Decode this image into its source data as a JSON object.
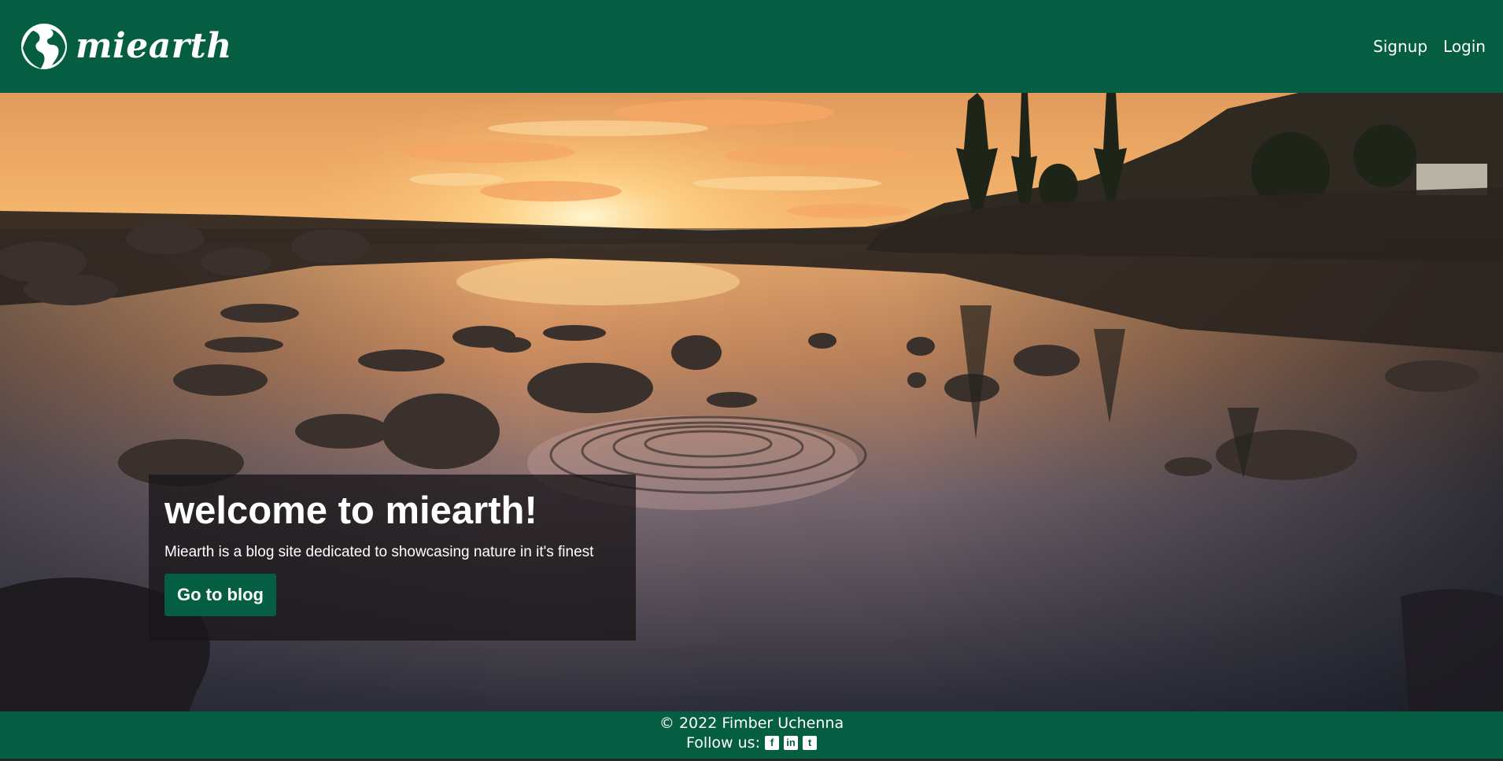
{
  "header": {
    "brand": "miearth",
    "nav": {
      "signup": "Signup",
      "login": "Login"
    }
  },
  "hero": {
    "title": "welcome to miearth!",
    "description": "Miearth is a blog site dedicated to showcasing nature in it's finest",
    "button_label": "Go to blog"
  },
  "footer": {
    "copyright": "© 2022 Fimber Uchenna",
    "follow_label": "Follow us:",
    "social": [
      "facebook-square-icon",
      "linkedin-square-icon",
      "twitter-square-icon"
    ]
  },
  "colors": {
    "brand_green": "#055e42",
    "card_background": "#191618"
  }
}
